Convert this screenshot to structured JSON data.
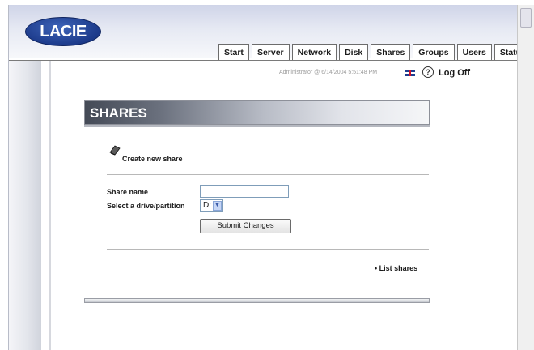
{
  "header": {
    "logo": "LACIE",
    "tabs": [
      "Start",
      "Server",
      "Network",
      "Disk",
      "Shares",
      "Groups",
      "Users",
      "Status"
    ]
  },
  "userbar": {
    "session_text": "Administrator @ 6/14/2004 5:51:48 PM",
    "help_symbol": "?",
    "logoff_label": "Log Off",
    "flag_icon": "uk-flag-icon"
  },
  "section": {
    "title": "SHARES"
  },
  "create": {
    "icon": "share-icon",
    "label": "Create new share"
  },
  "form": {
    "share_name_label": "Share name",
    "share_name_value": "",
    "drive_label": "Select a drive/partition",
    "drive_value": "D:",
    "submit_label": "Submit Changes"
  },
  "links": {
    "list_shares": "• List shares"
  },
  "colors": {
    "logo": "#1c3a8a",
    "tab_border": "#6c6c6c",
    "banner_dark": "#444a56"
  }
}
